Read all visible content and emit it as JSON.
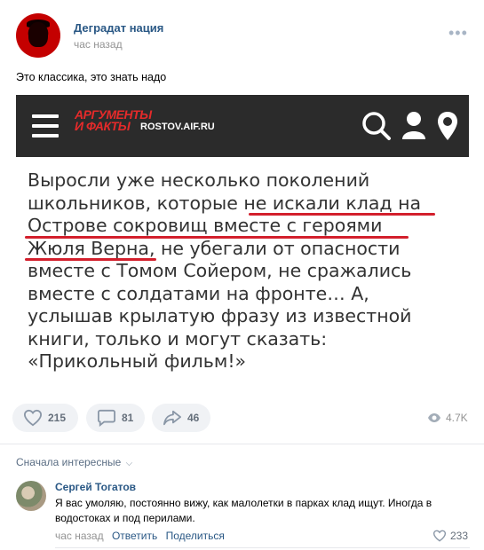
{
  "post": {
    "author": "Деградат нация",
    "time": "час назад",
    "more": "•••",
    "text": "Это классика, это знать надо"
  },
  "image": {
    "logo_line1": "АРГУМЕНТЫ",
    "logo_line2": "И ФАКТЫ",
    "site": "ROSTOV.AIF.RU",
    "quote_lines": [
      "Выросли уже несколько поколений",
      "школьников, которые не искали клад на",
      "Острове сокровищ вместе с героями",
      "Жюля Верна, не убегали от опасности",
      "вместе с Томом Сойером, не сражались",
      "вместе с солдатами на фронте… А,",
      "услышав крылатую фразу из известной",
      "книги, только и могут сказать:",
      "«Прикольный фильм!»"
    ],
    "underline_color": "#d31f2c",
    "header_bg": "#2b2b2b",
    "logo_color": "#e52a2a"
  },
  "actions": {
    "likes": "215",
    "comments": "81",
    "shares": "46",
    "views": "4.7K"
  },
  "comments_section": {
    "sort_label": "Сначала интересные",
    "comment": {
      "author": "Сергей Тогатов",
      "text": "Я вас умоляю, постоянно вижу, как малолетки в парках клад ищут. Иногда в водостоках и под перилами.",
      "time": "час назад",
      "reply": "Ответить",
      "share": "Поделиться",
      "likes": "233"
    }
  },
  "colors": {
    "link": "#2a5885",
    "muted": "#939393",
    "pill_bg": "#f0f2f5"
  }
}
